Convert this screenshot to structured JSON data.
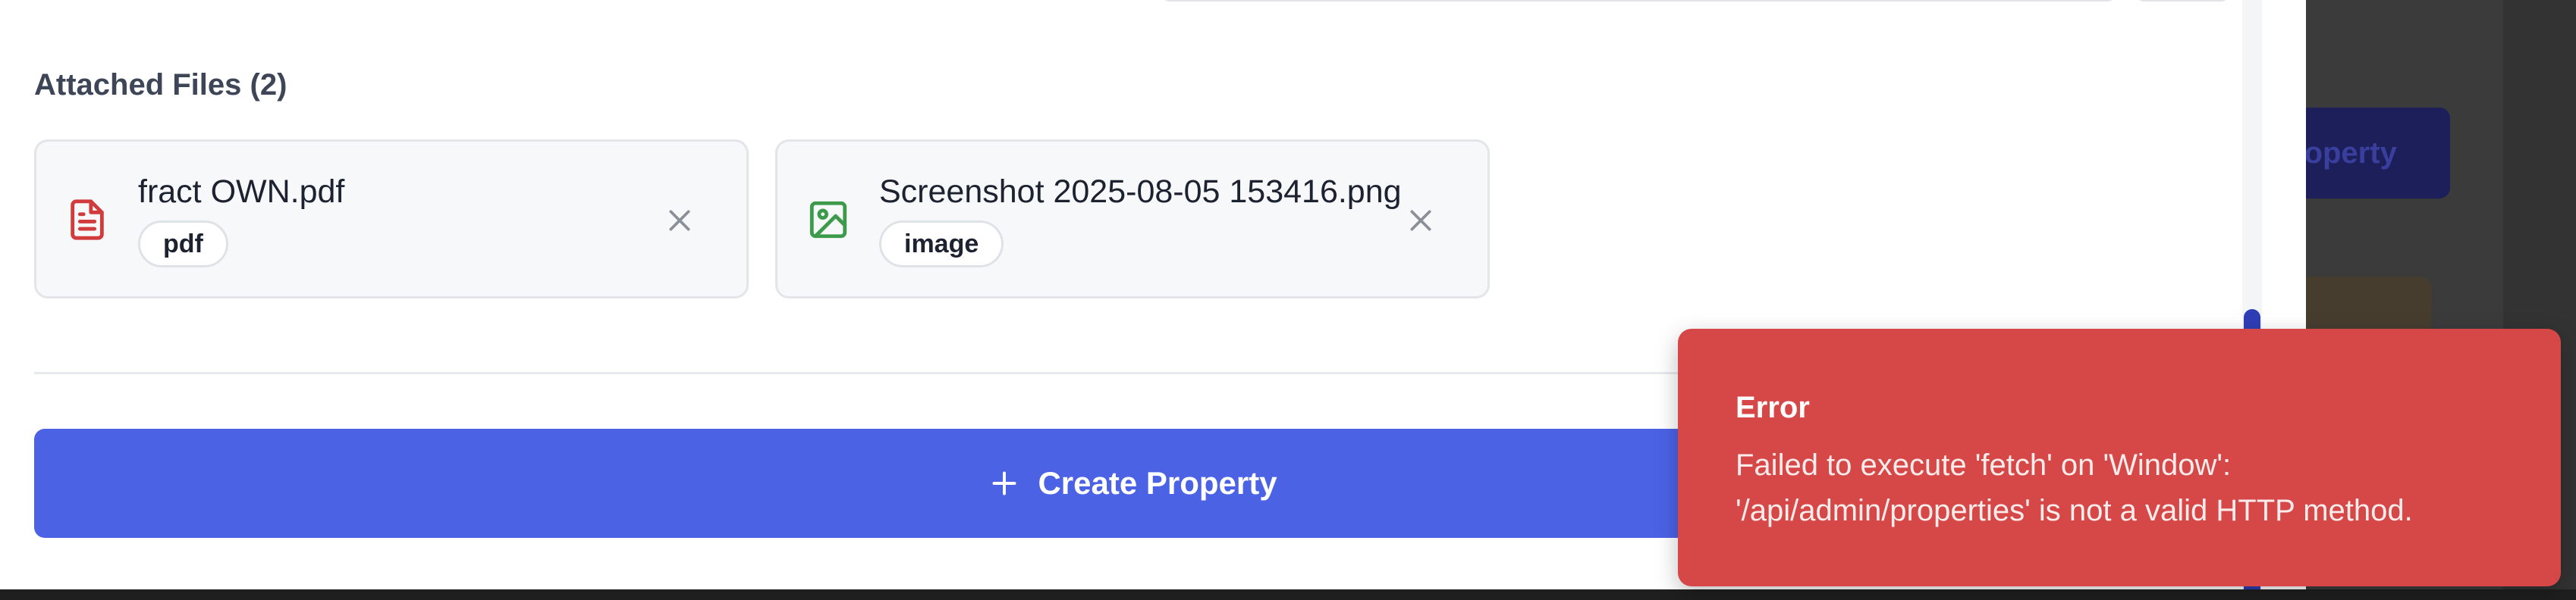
{
  "background": {
    "button_label": "roperty"
  },
  "attachments": {
    "title": "Attached Files (2)",
    "files": [
      {
        "name": "fract OWN.pdf",
        "type": "pdf",
        "icon": "file-text-icon",
        "icon_color": "#d23b3b"
      },
      {
        "name": "Screenshot 2025-08-05 153416.png",
        "type": "image",
        "icon": "image-icon",
        "icon_color": "#3c9a4a"
      }
    ]
  },
  "actions": {
    "create_label": "Create Property",
    "create_icon": "plus-icon",
    "primary_color": "#4b62e5"
  },
  "toast": {
    "title": "Error",
    "message": "Failed to execute 'fetch' on 'Window': '/api/admin/properties' is not a valid HTTP method.",
    "color": "#d64848"
  }
}
